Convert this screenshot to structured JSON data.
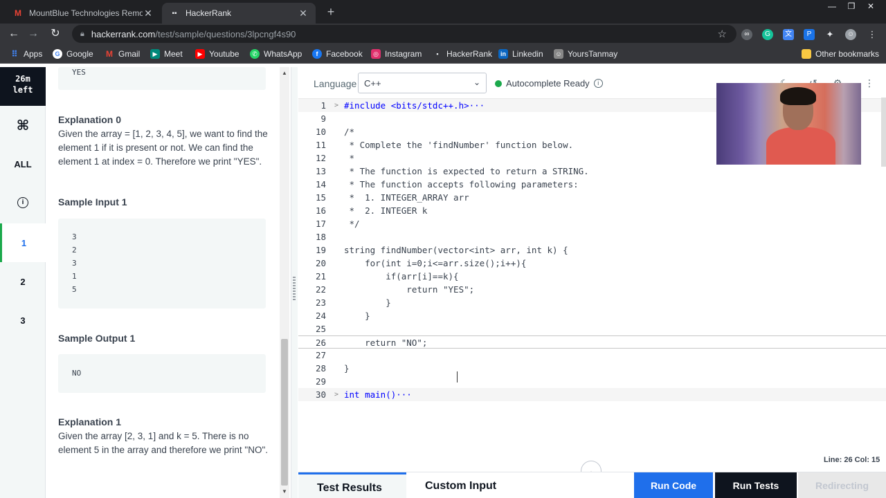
{
  "browser": {
    "tabs": [
      {
        "title": "MountBlue Technologies Remot",
        "icon": "gmail-icon"
      },
      {
        "title": "HackerRank",
        "icon": "hackerrank-icon"
      }
    ],
    "url_host": "hackerrank.com",
    "url_path": "/test/sample/questions/3lpcngf4s90"
  },
  "bookmarks": [
    {
      "label": "Apps",
      "color": "#4285f4"
    },
    {
      "label": "Google",
      "color": "#4285f4"
    },
    {
      "label": "Gmail",
      "color": "#ea4335"
    },
    {
      "label": "Meet",
      "color": "#00897b"
    },
    {
      "label": "Youtube",
      "color": "#ff0000"
    },
    {
      "label": "WhatsApp",
      "color": "#25d366"
    },
    {
      "label": "Facebook",
      "color": "#1877f2"
    },
    {
      "label": "Instagram",
      "color": "#e1306c"
    },
    {
      "label": "HackerRank",
      "color": "#2ec866"
    },
    {
      "label": "Linkedin",
      "color": "#0a66c2"
    },
    {
      "label": "YoursTanmay",
      "color": "#888888"
    }
  ],
  "other_bookmarks": "Other bookmarks",
  "rail": {
    "timer_line1": "26m",
    "timer_line2": "left",
    "all_label": "ALL",
    "questions": [
      "1",
      "2",
      "3"
    ]
  },
  "problem": {
    "top_output": "YES",
    "explanation0_title": "Explanation 0",
    "explanation0_text": "Given the array = [1, 2, 3, 4, 5], we want to find the element 1 if it is present or not. We can find the element 1 at index = 0. Therefore we print \"YES\".",
    "sample_input1_title": "Sample Input 1",
    "sample_input1_lines": [
      "3",
      "2",
      "3",
      "1",
      "5"
    ],
    "sample_output1_title": "Sample Output 1",
    "sample_output1": "NO",
    "explanation1_title": "Explanation 1",
    "explanation1_text": "Given the array [2, 3, 1] and k = 5. There is no element 5 in the array and therefore we print \"NO\"."
  },
  "editor": {
    "language_label": "Language",
    "language_value": "C++",
    "autocomplete": "Autocomplete Ready",
    "status": "Line: 26 Col: 15"
  },
  "code_lines": [
    {
      "n": "1",
      "text": "#include <bits/stdc++.h>···"
    },
    {
      "n": "9",
      "text": ""
    },
    {
      "n": "10",
      "text": "/*"
    },
    {
      "n": "11",
      "text": " * Complete the 'findNumber' function below."
    },
    {
      "n": "12",
      "text": " *"
    },
    {
      "n": "13",
      "text": " * The function is expected to return a STRING."
    },
    {
      "n": "14",
      "text": " * The function accepts following parameters:"
    },
    {
      "n": "15",
      "text": " *  1. INTEGER_ARRAY arr"
    },
    {
      "n": "16",
      "text": " *  2. INTEGER k"
    },
    {
      "n": "17",
      "text": " */"
    },
    {
      "n": "18",
      "text": ""
    },
    {
      "n": "19",
      "text": "string findNumber(vector<int> arr, int k) {"
    },
    {
      "n": "20",
      "text": "    for(int i=0;i<=arr.size();i++){"
    },
    {
      "n": "21",
      "text": "        if(arr[i]==k){"
    },
    {
      "n": "22",
      "text": "            return \"YES\";"
    },
    {
      "n": "23",
      "text": "        }"
    },
    {
      "n": "24",
      "text": "    }"
    },
    {
      "n": "25",
      "text": ""
    },
    {
      "n": "26",
      "text": "    return \"NO\";"
    },
    {
      "n": "27",
      "text": ""
    },
    {
      "n": "28",
      "text": "}"
    },
    {
      "n": "29",
      "text": ""
    },
    {
      "n": "30",
      "text": "int main()···"
    }
  ],
  "bottom": {
    "test_results": "Test Results",
    "custom_input": "Custom Input",
    "run_code": "Run Code",
    "run_tests": "Run Tests",
    "redirecting": "Redirecting"
  }
}
